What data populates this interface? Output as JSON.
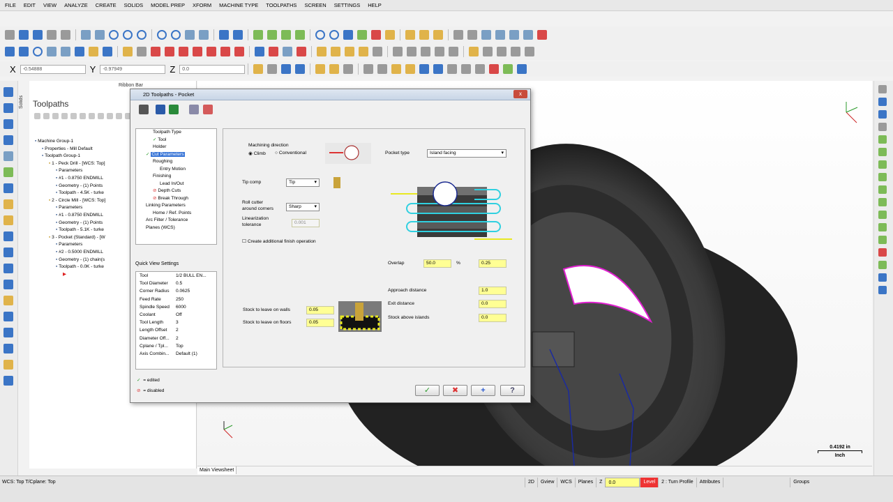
{
  "menu": [
    "FILE",
    "EDIT",
    "VIEW",
    "ANALYZE",
    "CREATE",
    "SOLIDS",
    "MODEL PREP",
    "XFORM",
    "MACHINE TYPE",
    "TOOLPATHS",
    "SCREEN",
    "SETTINGS",
    "HELP"
  ],
  "coords": {
    "x_label": "X",
    "x_value": "-0.54888",
    "y_label": "Y",
    "y_value": "-0.97949",
    "z_label": "Z",
    "z_value": "0.0"
  },
  "ribbon_bar_label": "Ribbon Bar",
  "solids_tab": "Solids",
  "toolpaths_panel": {
    "title": "Toolpaths",
    "tree": [
      "Machine Group-1",
      "Properties - Mill Default",
      "Toolpath Group-1",
      "1 - Peck Drill - [WCS: Top]",
      "Parameters",
      "#1 - 0.8750 ENDMILL",
      "Geometry - (1) Points",
      "Toolpath - 4.5K - turke",
      "2 - Circle Mill - [WCS: Top]",
      "Parameters",
      "#1 - 0.8750 ENDMILL",
      "Geometry - (1) Points",
      "Toolpath - 5.1K - turke",
      "3 - Pocket (Standard) - [W",
      "Parameters",
      "#2 - 0.5000 ENDMILL",
      "Geometry - (1) chain(s",
      "Toolpath - 0.0K - turke"
    ]
  },
  "dialog": {
    "title": "2D Toolpaths - Pocket",
    "close": "x",
    "nav": [
      "Toolpath Type",
      "Tool",
      "Holder",
      "Cut Parameters",
      "Roughing",
      "Entry Motion",
      "Finishing",
      "Lead In/Out",
      "Depth Cuts",
      "Break Through",
      "Linking Parameters",
      "Home / Ref. Points",
      "Arc Filter / Tolerance",
      "Planes (WCS)"
    ],
    "quick_view_label": "Quick View Settings",
    "quick_view": [
      {
        "k": "Tool",
        "v": "1/2 BULL EN..."
      },
      {
        "k": "Tool Diameter",
        "v": "0.5"
      },
      {
        "k": "Corner Radius",
        "v": "0.0625"
      },
      {
        "k": "Feed Rate",
        "v": "250"
      },
      {
        "k": "Spindle Speed",
        "v": "6000"
      },
      {
        "k": "Coolant",
        "v": "Off"
      },
      {
        "k": "Tool Length",
        "v": "3"
      },
      {
        "k": "Length Offset",
        "v": "2"
      },
      {
        "k": "Diameter Off...",
        "v": "2"
      },
      {
        "k": "Cplane / Tpl...",
        "v": "Top"
      },
      {
        "k": "Axis Combin...",
        "v": "Default (1)"
      }
    ],
    "legend": {
      "edited": "= edited",
      "disabled": "= disabled"
    },
    "machining_direction": {
      "label": "Machining direction",
      "climb": "Climb",
      "conventional": "Conventional"
    },
    "pocket_type": {
      "label": "Pocket type",
      "value": "Island facing"
    },
    "tip_comp": {
      "label": "Tip comp",
      "value": "Tip"
    },
    "roll_cutter": {
      "label1": "Roll cutter",
      "label2": "around corners",
      "value": "Sharp"
    },
    "linearization": {
      "label1": "Linearization",
      "label2": "tolerance",
      "value": "0.001"
    },
    "finish_op": "Create additional finish operation",
    "overlap": {
      "label": "Overlap",
      "pct": "50.0",
      "unit": "%",
      "value": "0.25"
    },
    "approach": {
      "label": "Approach distance",
      "value": "1.0"
    },
    "exit": {
      "label": "Exit distance",
      "value": "0.0"
    },
    "stock_islands": {
      "label": "Stock above islands",
      "value": "0.0"
    },
    "stock_walls": {
      "label": "Stock to leave on walls",
      "value": "0.05"
    },
    "stock_floors": {
      "label": "Stock to leave on floors",
      "value": "0.05"
    },
    "buttons": {
      "ok": "✓",
      "cancel": "✖",
      "add": "+",
      "help": "?"
    }
  },
  "viewsheet": "Main Viewsheet",
  "scale": {
    "value": "0.4192 in",
    "unit": "Inch"
  },
  "status": {
    "wcs": "WCS: Top  T/Cplane: Top",
    "items": [
      "2D",
      "Gview",
      "WCS",
      "Planes",
      "Z",
      "0.0",
      "Level",
      "2 : Turn Profile",
      "Attributes",
      "Groups"
    ]
  },
  "colors": {
    "accent": "#3875d7",
    "field": "#ffff94",
    "cyan": "#30d0e0",
    "magenta": "#e020d0"
  }
}
